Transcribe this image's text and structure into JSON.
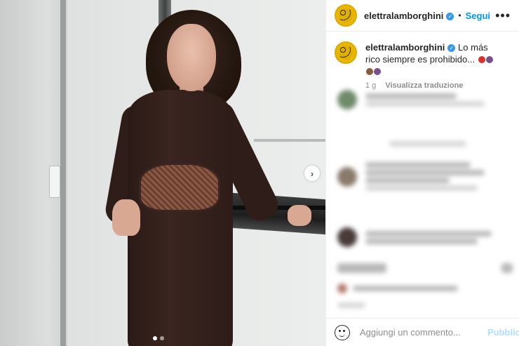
{
  "post": {
    "username": "elettralamborghini",
    "follow_label": "Segui",
    "separator": "•",
    "more_label": "•••",
    "caption_text": "Lo más rico siempre es prohibido...",
    "caption_emojis": [
      "#d9302a",
      "#7a4f8a",
      "#8a5a3c",
      "#7a4f8a"
    ],
    "time_ago": "1 g",
    "translate_label": "Visualizza traduzione",
    "next_label": "›",
    "carousel": {
      "count": 2,
      "active": 0
    }
  },
  "composer": {
    "placeholder": "Aggiungi un commento...",
    "publish_label": "Pubblica"
  },
  "colors": {
    "link": "#0095f6",
    "verified": "#3897f0",
    "publish_disabled": "#b2dffc"
  }
}
